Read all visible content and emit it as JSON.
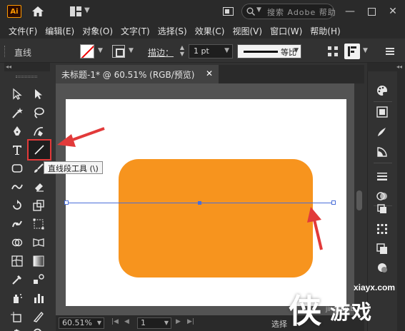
{
  "app": {
    "logo_text": "Ai",
    "search_placeholder": "搜索 Adobe 帮助"
  },
  "menu": [
    "文件(F)",
    "编辑(E)",
    "对象(O)",
    "文字(T)",
    "选择(S)",
    "效果(C)",
    "视图(V)",
    "窗口(W)",
    "帮助(H)"
  ],
  "control_bar": {
    "object_label": "直线",
    "stroke_label": "描边：",
    "stroke_weight": "1 pt",
    "profile_label": "等比"
  },
  "document": {
    "tab_title": "未标题-1* @ 60.51% (RGB/预览)",
    "shape_color": "#f7941e",
    "path_color": "#4a6fd9"
  },
  "tooltip": "直线段工具 (\\)",
  "status": {
    "zoom": "60.51%",
    "page": "1",
    "text": "选择"
  },
  "watermark": {
    "url": "xiayx.com",
    "big": "侠",
    "word": "游戏",
    "small": "jingyan.b"
  },
  "colors": {
    "annotation_red": "#e23a3a",
    "accent_orange": "#ff9a00"
  }
}
